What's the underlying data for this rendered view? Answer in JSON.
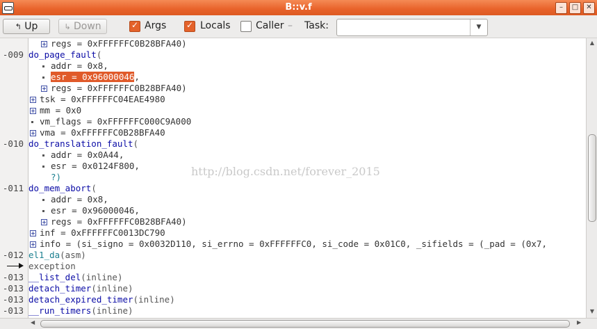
{
  "window": {
    "title": "B::v.f"
  },
  "toolbar": {
    "up_label": "Up",
    "down_label": "Down",
    "args_label": "Args",
    "locals_label": "Locals",
    "caller_label": "Caller",
    "caller_sep": "–",
    "task_label": "Task:",
    "task_value": "",
    "args_checked": true,
    "locals_checked": true,
    "caller_checked": false
  },
  "stack": {
    "lines": [
      {
        "level": "",
        "kind": "plus",
        "indent": 1,
        "text": "regs = 0xFFFFFFC0B28BFA40)"
      },
      {
        "level": "-009",
        "kind": "func",
        "indent": 0,
        "name": "do_page_fault",
        "rest": "("
      },
      {
        "level": "",
        "kind": "dot",
        "indent": 1,
        "text": "addr = 0x8,"
      },
      {
        "level": "",
        "kind": "dot-hl",
        "indent": 1,
        "hl": "esr = 0x96000046",
        "rest": ","
      },
      {
        "level": "",
        "kind": "plus",
        "indent": 1,
        "text": "regs = 0xFFFFFFC0B28BFA40)"
      },
      {
        "level": "",
        "kind": "plus",
        "indent": 0,
        "text": "tsk = 0xFFFFFFC04EAE4980"
      },
      {
        "level": "",
        "kind": "plus",
        "indent": 0,
        "text": "mm = 0x0"
      },
      {
        "level": "",
        "kind": "dot",
        "indent": 0,
        "text": "vm_flags = 0xFFFFFFC000C9A000"
      },
      {
        "level": "",
        "kind": "plus",
        "indent": 0,
        "text": "vma = 0xFFFFFFC0B28BFA40"
      },
      {
        "level": "-010",
        "kind": "func",
        "indent": 0,
        "name": "do_translation_fault",
        "rest": "("
      },
      {
        "level": "",
        "kind": "dot",
        "indent": 1,
        "text": "addr = 0x0A44,"
      },
      {
        "level": "",
        "kind": "dot",
        "indent": 1,
        "text": "esr = 0x0124F800,"
      },
      {
        "level": "",
        "kind": "plain",
        "indent": 1,
        "text": "?)"
      },
      {
        "level": "-011",
        "kind": "func",
        "indent": 0,
        "name": "do_mem_abort",
        "rest": "("
      },
      {
        "level": "",
        "kind": "dot",
        "indent": 1,
        "text": "addr = 0x8,"
      },
      {
        "level": "",
        "kind": "dot",
        "indent": 1,
        "text": "esr = 0x96000046,"
      },
      {
        "level": "",
        "kind": "plus",
        "indent": 1,
        "text": "regs = 0xFFFFFFC0B28BFA40)"
      },
      {
        "level": "",
        "kind": "plus",
        "indent": 0,
        "text": "inf = 0xFFFFFFC0013DC790"
      },
      {
        "level": "",
        "kind": "plus",
        "indent": 0,
        "text": "info = (si_signo = 0x0032D110, si_errno = 0xFFFFFFC0, si_code = 0x01C0, _sifields = (_pad = (0x7,"
      },
      {
        "level": "-012",
        "kind": "teal",
        "indent": 0,
        "name": "el1_da",
        "rest": "(asm)"
      },
      {
        "level": "",
        "kind": "arrow",
        "indent": 0,
        "text": "exception"
      },
      {
        "level": "-013",
        "kind": "func",
        "indent": 0,
        "name": "__list_del",
        "rest": "(inline)"
      },
      {
        "level": "-013",
        "kind": "func",
        "indent": 0,
        "name": "detach_timer",
        "rest": "(inline)"
      },
      {
        "level": "-013",
        "kind": "func",
        "indent": 0,
        "name": "detach_expired_timer",
        "rest": "(inline)"
      },
      {
        "level": "-013",
        "kind": "func",
        "indent": 0,
        "name": "__run_timers",
        "rest": "(inline)"
      }
    ]
  },
  "watermark": "http://blog.csdn.net/forever_2015"
}
